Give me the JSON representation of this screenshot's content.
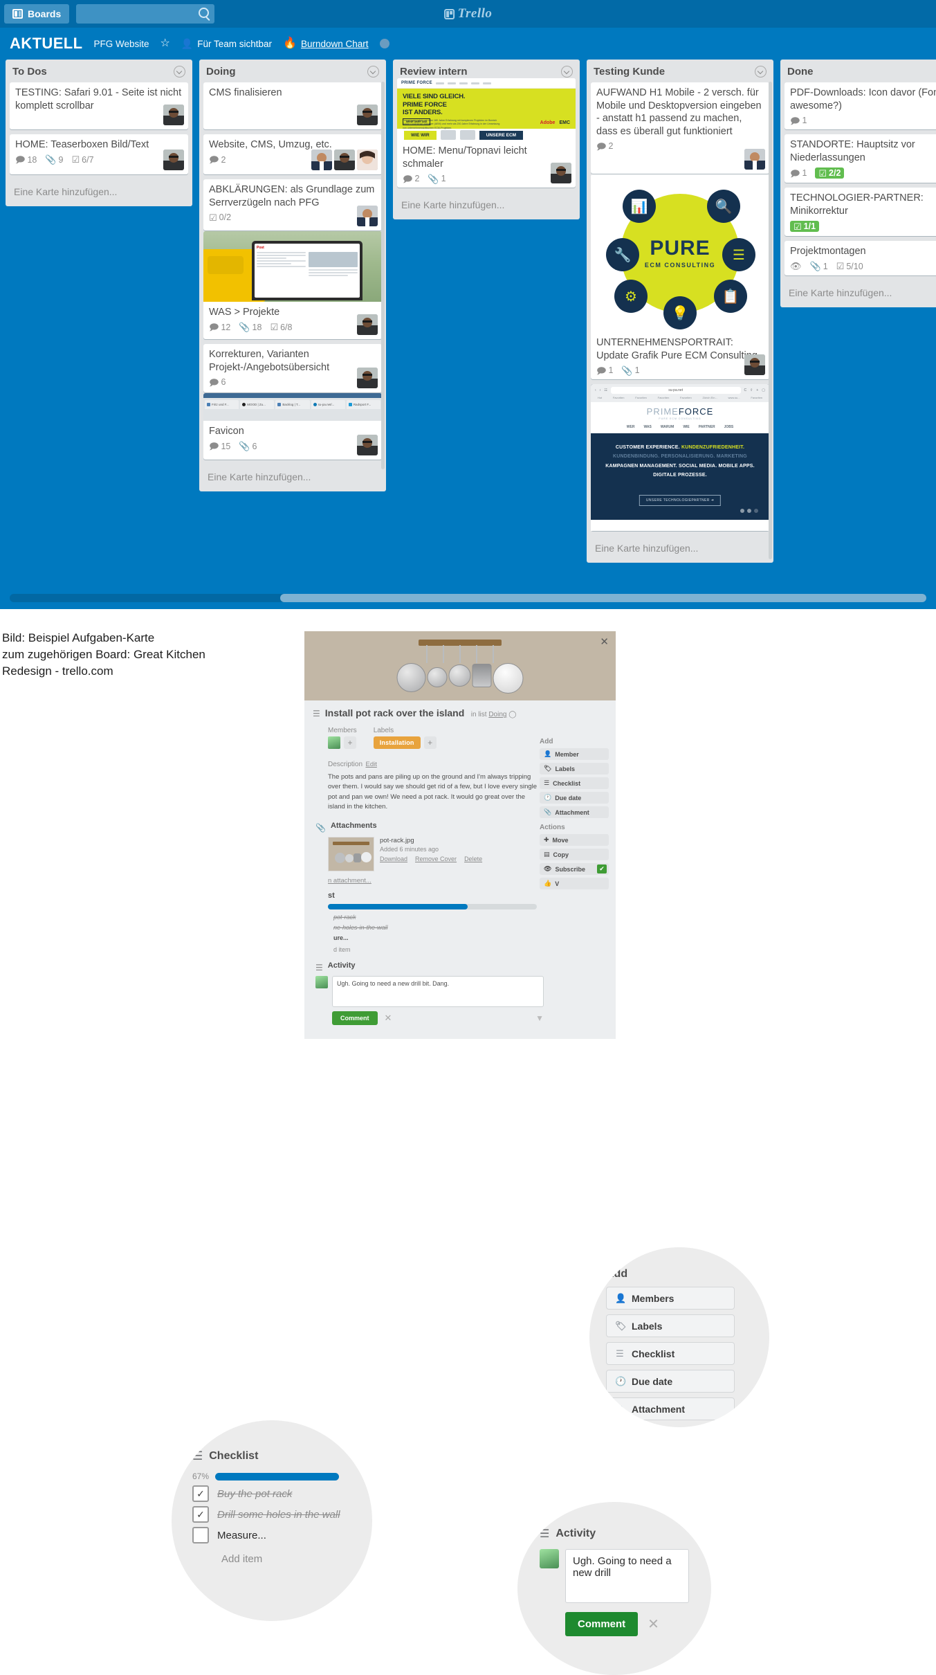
{
  "app": {
    "header": {
      "boards_button": "Boards",
      "search_placeholder": "",
      "search_value": "",
      "logo_text": "Trello"
    },
    "board_bar": {
      "board_name": "AKTUELL",
      "team_name": "PFG Website",
      "star_icon": "star-icon",
      "visibility": "Für Team sichtbar",
      "powerup_icon": "flame-icon",
      "powerup_label": "Burndown Chart",
      "member_avatar": "avatar"
    },
    "add_card_label": "Eine Karte hinzufügen...",
    "lists": [
      {
        "title": "To Dos",
        "cards": [
          {
            "title": "TESTING: Safari 9.01 - Seite ist nicht komplett scrollbar",
            "badges": [],
            "members": 1
          },
          {
            "title": "HOME: Teaserboxen Bild/Text",
            "badges": [
              {
                "icon": "comment-icon",
                "text": "18"
              },
              {
                "icon": "attachment-icon",
                "text": "9"
              },
              {
                "icon": "checklist-icon",
                "text": "6/7"
              }
            ],
            "members": 1
          }
        ]
      },
      {
        "title": "Doing",
        "cards": [
          {
            "title": "CMS finalisieren",
            "badges": [],
            "members": 1
          },
          {
            "title": "Website, CMS, Umzug, etc.",
            "badges": [
              {
                "icon": "comment-icon",
                "text": "2"
              }
            ],
            "members": 3
          },
          {
            "title": "ABKLÄRUNGEN: als Grundlage zum Serrverzügeln nach PFG",
            "badges": [
              {
                "icon": "checklist-icon",
                "text": "0/2"
              }
            ],
            "members": 1
          },
          {
            "title": "WAS > Projekte",
            "cover": "laptop-van-photo",
            "badges": [
              {
                "icon": "comment-icon",
                "text": "12"
              },
              {
                "icon": "attachment-icon",
                "text": "18"
              },
              {
                "icon": "checklist-icon",
                "text": "6/8"
              }
            ],
            "members": 1
          },
          {
            "title": "Korrekturen, Varianten Projekt-/Angebotsübersicht",
            "badges": [
              {
                "icon": "comment-icon",
                "text": "6"
              }
            ],
            "members": 1
          },
          {
            "title": "Favicon",
            "cover": "browser-tabs-screenshot",
            "badges": [
              {
                "icon": "comment-icon",
                "text": "15"
              },
              {
                "icon": "attachment-icon",
                "text": "6"
              }
            ],
            "members": 1
          }
        ]
      },
      {
        "title": "Review intern",
        "cards": [
          {
            "title": "HOME: Menu/Topnavi leicht schmaler",
            "cover": "prime-force-hero-screenshot",
            "badges": [
              {
                "icon": "comment-icon",
                "text": "2"
              },
              {
                "icon": "attachment-icon",
                "text": "1"
              }
            ],
            "members": 1
          }
        ]
      },
      {
        "title": "Testing Kunde",
        "cards": [
          {
            "title": "AUFWAND H1 Mobile - 2 versch. für Mobile und Desktopversion eingeben - anstatt h1 passend zu machen, dass es überall gut funktioniert",
            "badges": [
              {
                "icon": "comment-icon",
                "text": "2"
              }
            ],
            "members": 1
          },
          {
            "title": "UNTERNEHMENSPORTRAIT: Update Grafik Pure ECM Consulting",
            "cover": "pure-ecm-consulting-graphic",
            "badges": [
              {
                "icon": "comment-icon",
                "text": "1"
              },
              {
                "icon": "attachment-icon",
                "text": "1"
              }
            ],
            "members": 1
          },
          {
            "title": "",
            "cover": "prime-force-mobile-site-screenshot",
            "badges": [],
            "members": 0
          }
        ]
      },
      {
        "title": "Done",
        "cards": [
          {
            "title": "PDF-Downloads: Icon davor (Font awesome?)",
            "badges": [
              {
                "icon": "comment-icon",
                "text": "1"
              }
            ],
            "members": 0
          },
          {
            "title": "STANDORTE: Hauptsitz vor Niederlassungen",
            "badges": [
              {
                "icon": "comment-icon",
                "text": "1"
              },
              {
                "icon": "checklist-icon",
                "text": "2/2",
                "style": "green"
              }
            ],
            "members": 0
          },
          {
            "title": "TECHNOLOGIER-PARTNER: Minikorrektur",
            "badges": [
              {
                "icon": "checklist-icon",
                "text": "1/1",
                "style": "green"
              }
            ],
            "members": 0
          },
          {
            "title": "Projektmontagen",
            "badges": [
              {
                "icon": "watch-icon",
                "text": ""
              },
              {
                "icon": "attachment-icon",
                "text": "1"
              },
              {
                "icon": "checklist-icon",
                "text": "5/10"
              }
            ],
            "members": 0
          }
        ]
      }
    ],
    "covers": {
      "prime_force_hero": {
        "logo": "PRIME FORCE",
        "headline_1": "VIELE SIND GLEICH.",
        "headline_2": "PRIME FORCE",
        "headline_3": "IST ANDERS.",
        "body": "Gemeinsam haben wir über 180 Jahre Erfahrung mit komplexen Projekten im Bereich Adobe Experience Manager (AEM) und mehr als 200 Jahre Erfahrung in der Umsetzung von unternehmenskritischen ECM-Projekten.",
        "cta": "MEHR ÜBER UNS",
        "brand_1": "Adobe",
        "brand_2": "EMC",
        "strip_1": "WIE WIR",
        "strip_2": "UNSERE ECM"
      },
      "pure_ecm": {
        "title": "PURE",
        "subtitle": "ECM CONSULTING"
      },
      "prime_force_site": {
        "url": "su-pa.net",
        "logo_light": "PRIME",
        "logo_bold": "FORCE",
        "logo_tag": "PURE ECM CONSULTING",
        "menu": [
          "WER",
          "WAS",
          "WARUM",
          "WIE",
          "PARTNER",
          "JOBS"
        ],
        "claim_line_1": "CUSTOMER EXPERIENCE.",
        "claim_highlight": "KUNDENZUFRIEDENHEIT.",
        "claim_line_2": "KUNDENBINDUNG. PERSONALISIERUNG. MARKETING",
        "claim_line_3": "KAMPAGNEN MANAGEMENT. SOCIAL MEDIA. MOBILE APPS.",
        "claim_line_4": "DIGITALE PROZESSE.",
        "cta": "UNSERE TECHNOLOGIEPARTNER ➜"
      },
      "browser_tabs": [
        "Fritz und F...",
        "MOOD | Zu...",
        "Backlog | T...",
        "su-pa.net/...",
        "Radsport F..."
      ],
      "laptop": {
        "brand": "Post"
      }
    }
  },
  "caption": {
    "line1": "Bild: Beispiel Aufgaben-Karte",
    "line2": "zum zugehörigen Board: Great Kitchen",
    "line3": "Redesign - trello.com"
  },
  "card_detail": {
    "close_label": "✕",
    "title": "Install pot rack over the island",
    "in_list_prefix": "in list",
    "in_list_name": "Doing",
    "members_label": "Members",
    "labels_label": "Labels",
    "label_chip": "Installation",
    "add_plus": "+",
    "description_label": "Description",
    "edit_label": "Edit",
    "description": "The pots and pans are piling up on the ground and I'm always tripping over them. I would say we should get rid of a few, but I love every single pot and pan we own! We need a pot rack. It would go great over the island in the kitchen.",
    "attachments_label": "Attachments",
    "attachment_name": "pot-rack.jpg",
    "attachment_added": "Added 6 minutes ago",
    "attachment_actions": [
      "Download",
      "Remove Cover",
      "Delete"
    ],
    "add_attachment_label": "n attachment...",
    "checklist_label": "st",
    "checklist_items": [
      "pot-rack",
      "ne-holes-in-the-wall",
      "ure..."
    ],
    "checklist_add": "d item",
    "activity_label": "Activity",
    "comment_value": "Ugh. Going to need a new drill bit. Dang.",
    "comment_button": "Comment",
    "dismiss_label": "✕",
    "sidebar": {
      "add_label": "Add",
      "add_buttons": [
        "Member",
        "Labels",
        "Checklist",
        "Due date",
        "Attachment"
      ],
      "actions_label": "Actions",
      "action_buttons": [
        "Move",
        "Copy",
        "Subscribe",
        "V"
      ],
      "subscribe_checked": "✔"
    }
  },
  "magnifiers": {
    "add": {
      "title": "Add",
      "buttons": [
        {
          "icon": "member-icon",
          "label": "Members"
        },
        {
          "icon": "label-icon",
          "label": "Labels"
        },
        {
          "icon": "checklist-icon",
          "label": "Checklist"
        },
        {
          "icon": "clock-icon",
          "label": "Due date"
        },
        {
          "icon": "attachment-icon",
          "label": "Attachment"
        }
      ]
    },
    "checklist": {
      "icon": "checklist-icon",
      "title": "Checklist",
      "percent": "67%",
      "progress": 67,
      "items": [
        {
          "label": "Buy the pot rack",
          "checked": true
        },
        {
          "label": "Drill some holes in the wall",
          "checked": true
        },
        {
          "label": "Measure...",
          "checked": false
        }
      ],
      "add_item": "Add item"
    },
    "activity": {
      "icon": "activity-icon",
      "title": "Activity",
      "comment": "Ugh. Going to need a new drill",
      "button": "Comment",
      "dismiss": "✕"
    }
  },
  "colors": {
    "board_blue": "#0079bf",
    "top_bar_blue": "#026aa7",
    "list_grey": "#e2e4e6",
    "green_badge": "#61bd4f",
    "orange_label": "#e8a33d",
    "comment_green": "#1e8a2f",
    "progress_blue": "#0079bf",
    "pure_yellow": "#d7e021",
    "flame_orange": "#eb7c34"
  }
}
